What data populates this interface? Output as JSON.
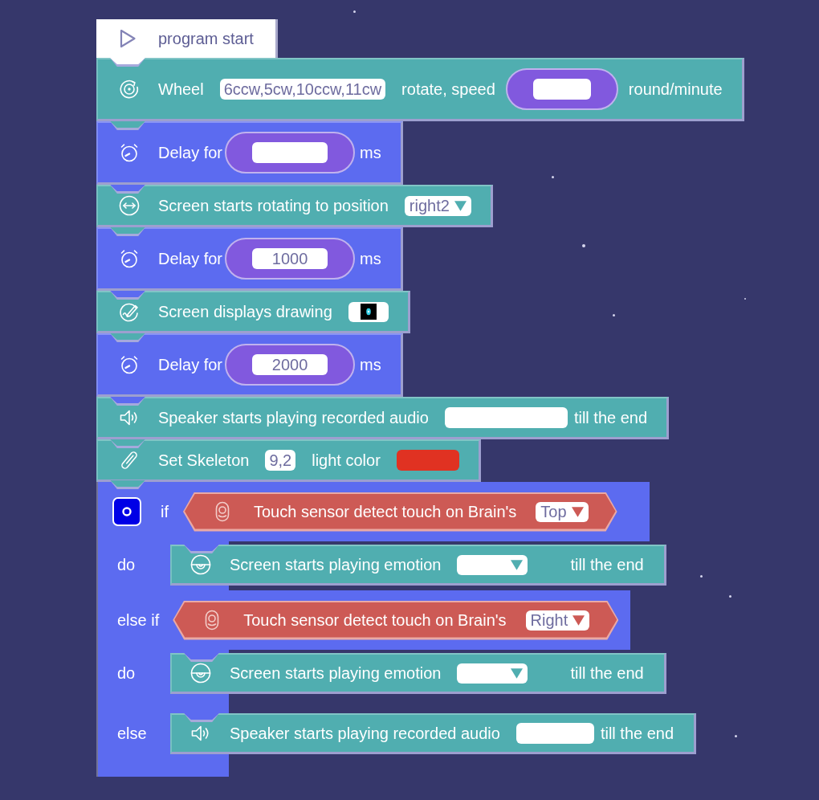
{
  "start": {
    "label": "program start"
  },
  "blocks": [
    {
      "kind": "wheel",
      "parts": [
        {
          "kind": "text",
          "text": "Wheel"
        },
        {
          "kind": "field",
          "value": "6ccw,5cw,10ccw,11cw"
        },
        {
          "kind": "text",
          "text": "rotate, speed"
        },
        {
          "kind": "number"
        },
        {
          "kind": "text",
          "text": "round/minute"
        }
      ]
    },
    {
      "kind": "delay",
      "parts": [
        {
          "kind": "text",
          "text": "Delay for"
        },
        {
          "kind": "number"
        },
        {
          "kind": "text",
          "text": "ms"
        }
      ]
    },
    {
      "kind": "rotate",
      "parts": [
        {
          "kind": "text",
          "text": "Screen starts rotating to position"
        },
        {
          "kind": "dropdown",
          "value": "right2"
        }
      ]
    },
    {
      "kind": "delay",
      "parts": [
        {
          "kind": "text",
          "text": "Delay for"
        },
        {
          "kind": "number",
          "value": "1000"
        },
        {
          "kind": "text",
          "text": "ms"
        }
      ]
    },
    {
      "kind": "drawing",
      "parts": [
        {
          "kind": "text",
          "text": "Screen displays drawing"
        },
        {
          "kind": "image"
        }
      ]
    },
    {
      "kind": "delay",
      "parts": [
        {
          "kind": "text",
          "text": "Delay for"
        },
        {
          "kind": "number",
          "value": "2000"
        },
        {
          "kind": "text",
          "text": "ms"
        }
      ]
    },
    {
      "kind": "speaker",
      "parts": [
        {
          "kind": "text",
          "text": "Speaker starts playing recorded audio"
        },
        {
          "kind": "field"
        },
        {
          "kind": "text",
          "text": "till the end"
        }
      ]
    },
    {
      "kind": "light",
      "parts": [
        {
          "kind": "text",
          "text": "Set Skeleton"
        },
        {
          "kind": "field",
          "value": "9,2"
        },
        {
          "kind": "text",
          "text": "light color"
        },
        {
          "kind": "color",
          "color": "#e03222"
        }
      ]
    },
    {
      "kind": "ifelse",
      "sections": [
        {
          "kind": "if",
          "label": "if",
          "condition": {
            "kind": "touch",
            "parts": [
              {
                "kind": "text",
                "text": "Touch sensor detect touch on Brain's"
              },
              {
                "kind": "dropdown",
                "value": "Top"
              }
            ]
          }
        },
        {
          "kind": "do",
          "label": "do",
          "statement": {
            "kind": "emotion",
            "parts": [
              {
                "kind": "text",
                "text": "Screen starts playing emotion"
              },
              {
                "kind": "dropdown"
              },
              {
                "kind": "text",
                "text": "till the end"
              }
            ]
          }
        },
        {
          "kind": "elseif",
          "label": "else if",
          "condition": {
            "kind": "touch",
            "parts": [
              {
                "kind": "text",
                "text": "Touch sensor detect touch on Brain's"
              },
              {
                "kind": "dropdown",
                "value": "Right"
              }
            ]
          }
        },
        {
          "kind": "do",
          "label": "do",
          "statement": {
            "kind": "emotion",
            "parts": [
              {
                "kind": "text",
                "text": "Screen starts playing emotion"
              },
              {
                "kind": "dropdown"
              },
              {
                "kind": "text",
                "text": "till the end"
              }
            ]
          }
        },
        {
          "kind": "else",
          "label": "else",
          "statement": {
            "kind": "speaker",
            "parts": [
              {
                "kind": "text",
                "text": "Speaker starts playing recorded audio"
              },
              {
                "kind": "field"
              },
              {
                "kind": "text",
                "text": "till the end"
              }
            ]
          }
        }
      ]
    }
  ]
}
